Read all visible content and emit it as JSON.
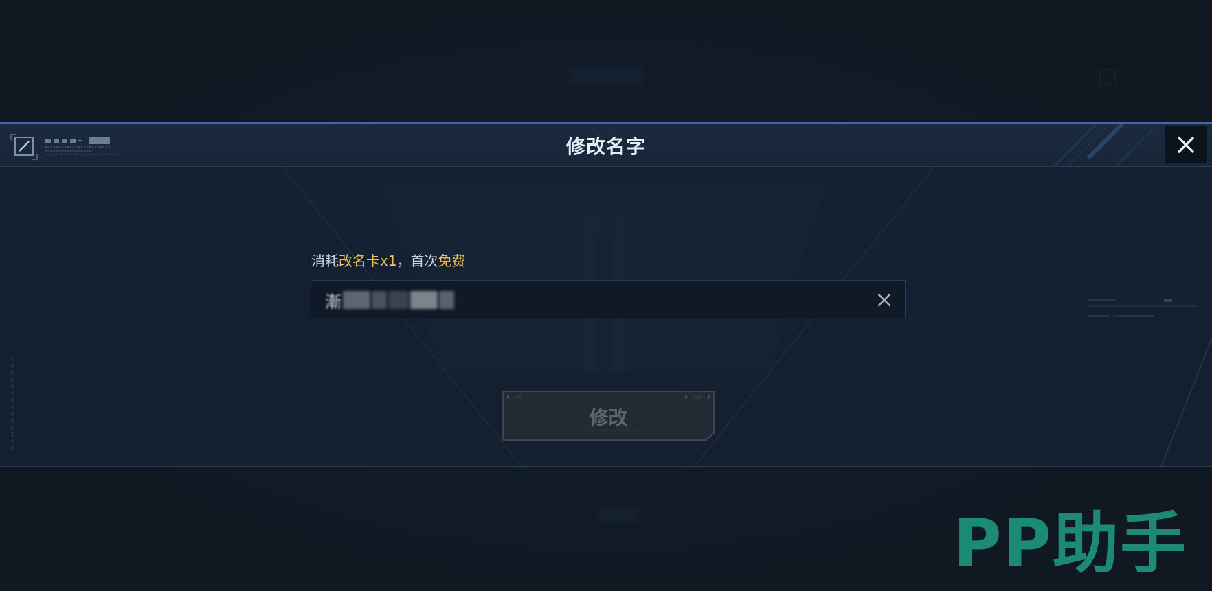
{
  "dialog": {
    "title": "修改名字",
    "cost_prefix": "消耗",
    "cost_item": "改名卡x1",
    "cost_sep": "，首次",
    "cost_free": "免费",
    "name_input": {
      "value_visible": "漸"
    },
    "submit_label": "修改"
  },
  "watermark": "PP助手",
  "colors": {
    "accent_yellow": "#f0c646",
    "header_border": "#3c6aa8",
    "watermark_green": "#1d8a76"
  },
  "icons": {
    "close": "close-icon",
    "clear": "clear-input-icon",
    "corner_logo": "edit-square-icon"
  }
}
